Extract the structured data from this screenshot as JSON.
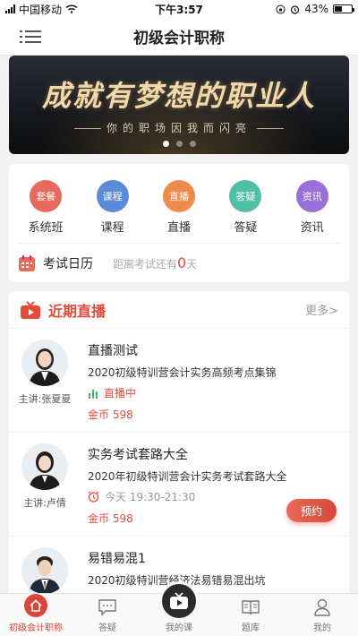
{
  "status_bar": {
    "carrier": "中国移动",
    "time": "下午3:57",
    "battery": "43%"
  },
  "nav": {
    "title": "初级会计职称"
  },
  "banner": {
    "slogan": "成就有梦想的职业人",
    "subtitle": "你的职场因我而闪亮"
  },
  "menu": {
    "items": [
      {
        "label": "系统班",
        "tag": "套餐",
        "color": "#e8695d"
      },
      {
        "label": "课程",
        "tag": "课程",
        "color": "#5b8bd8"
      },
      {
        "label": "直播",
        "tag": "直播",
        "color": "#f08a4b"
      },
      {
        "label": "答疑",
        "tag": "答疑",
        "color": "#4fc0a4"
      },
      {
        "label": "资讯",
        "tag": "资讯",
        "color": "#9b6fd8"
      }
    ]
  },
  "exam": {
    "title": "考试日历",
    "note_prefix": "距离考试还有",
    "days": "0",
    "unit": "天"
  },
  "live": {
    "title": "近期直播",
    "more": "更多>",
    "courses": [
      {
        "name": "直播测试",
        "desc": "2020初级特训营会计实务高频考点集锦",
        "status": "直播中",
        "price": "金币 598",
        "teacher": "主讲:张夏夏"
      },
      {
        "name": "实务考试套路大全",
        "desc": "2020年初级特训营会计实务考试套路大全",
        "status": "今天 19:30-21:30",
        "price": "金币 598",
        "teacher": "主讲:卢倩",
        "button": "预约"
      },
      {
        "name": "易错易混1",
        "desc": "2020初级特训营经济法易错易混出坑"
      }
    ]
  },
  "tabbar": {
    "tabs": [
      {
        "label": "初级会计职称"
      },
      {
        "label": "答疑"
      },
      {
        "label": "我的课"
      },
      {
        "label": "题库"
      },
      {
        "label": "我的"
      }
    ]
  }
}
